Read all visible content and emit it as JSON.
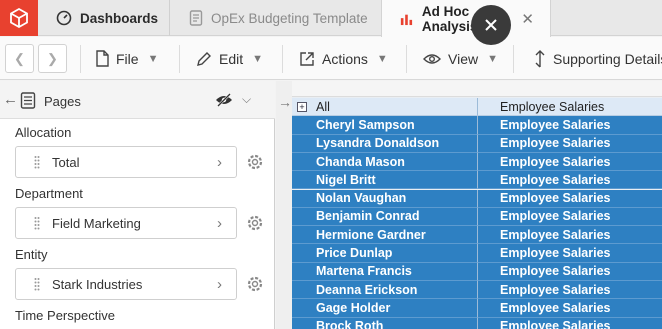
{
  "tabs": [
    {
      "label": "Dashboards",
      "icon": "dashboard-gauge-icon"
    },
    {
      "label": "OpEx Budgeting Template",
      "icon": "document-icon"
    },
    {
      "label": "Ad Hoc Analysis",
      "icon": "bar-chart-icon"
    }
  ],
  "toolbar": {
    "file": "File",
    "edit": "Edit",
    "actions": "Actions",
    "view": "View",
    "supporting": "Supporting Details"
  },
  "pages_panel": {
    "title": "Pages",
    "dimensions": [
      {
        "label": "Allocation",
        "value": "Total"
      },
      {
        "label": "Department",
        "value": "Field Marketing"
      },
      {
        "label": "Entity",
        "value": "Stark Industries"
      },
      {
        "label": "Time Perspective",
        "value": ""
      }
    ]
  },
  "grid": {
    "header": {
      "row": "All",
      "column": "Employee Salaries"
    },
    "rows": [
      {
        "name": "Cheryl Sampson",
        "account": "Employee Salaries"
      },
      {
        "name": "Lysandra Donaldson",
        "account": "Employee Salaries"
      },
      {
        "name": "Chanda Mason",
        "account": "Employee Salaries"
      },
      {
        "name": "Nigel Britt",
        "account": "Employee Salaries"
      },
      {
        "name": "Nolan Vaughan",
        "account": "Employee Salaries"
      },
      {
        "name": "Benjamin Conrad",
        "account": "Employee Salaries"
      },
      {
        "name": "Hermione Gardner",
        "account": "Employee Salaries"
      },
      {
        "name": "Price Dunlap",
        "account": "Employee Salaries"
      },
      {
        "name": "Martena Francis",
        "account": "Employee Salaries"
      },
      {
        "name": "Deanna Erickson",
        "account": "Employee Salaries"
      },
      {
        "name": "Gage Holder",
        "account": "Employee Salaries"
      },
      {
        "name": "Brock Roth",
        "account": "Employee Salaries"
      }
    ]
  },
  "colors": {
    "brand": "#e8412f",
    "selection": "#2e80c2"
  }
}
